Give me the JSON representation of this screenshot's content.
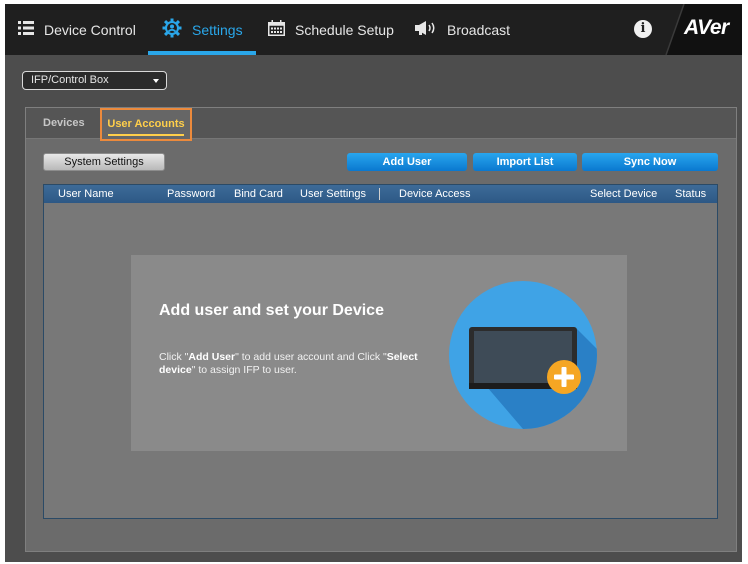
{
  "nav": {
    "items": [
      {
        "label": "Device Control",
        "icon": "list-icon"
      },
      {
        "label": "Settings",
        "icon": "gear-icon",
        "active": true
      },
      {
        "label": "Schedule Setup",
        "icon": "calendar-icon"
      },
      {
        "label": "Broadcast",
        "icon": "megaphone-icon"
      }
    ],
    "info_icon": "info-icon",
    "brand": "AVer",
    "accent_color": "#2aa7ea"
  },
  "device_select": {
    "value": "IFP/Control Box"
  },
  "tabs": [
    {
      "label": "Devices"
    },
    {
      "label": "User Accounts",
      "active": true
    }
  ],
  "toolbar": {
    "system_settings": "System Settings",
    "add_user": "Add User",
    "import_list": "Import List",
    "sync_now": "Sync Now"
  },
  "table": {
    "columns": [
      "User Name",
      "Password",
      "Bind Card",
      "User Settings",
      "Device Access",
      "Select Device",
      "Status"
    ]
  },
  "empty_state": {
    "title": "Add user and set your Device",
    "text_1": "Click \"",
    "link_1": "Add User",
    "text_2": "\" to add user account and Click \"",
    "link_2": "Select device",
    "text_3": "\" to assign IFP to user."
  },
  "colors": {
    "tab_highlight": "#ec8a3c",
    "tab_active_text": "#ffcf4a",
    "button_blue": "#1590df",
    "header_blue": "#355f8c"
  }
}
